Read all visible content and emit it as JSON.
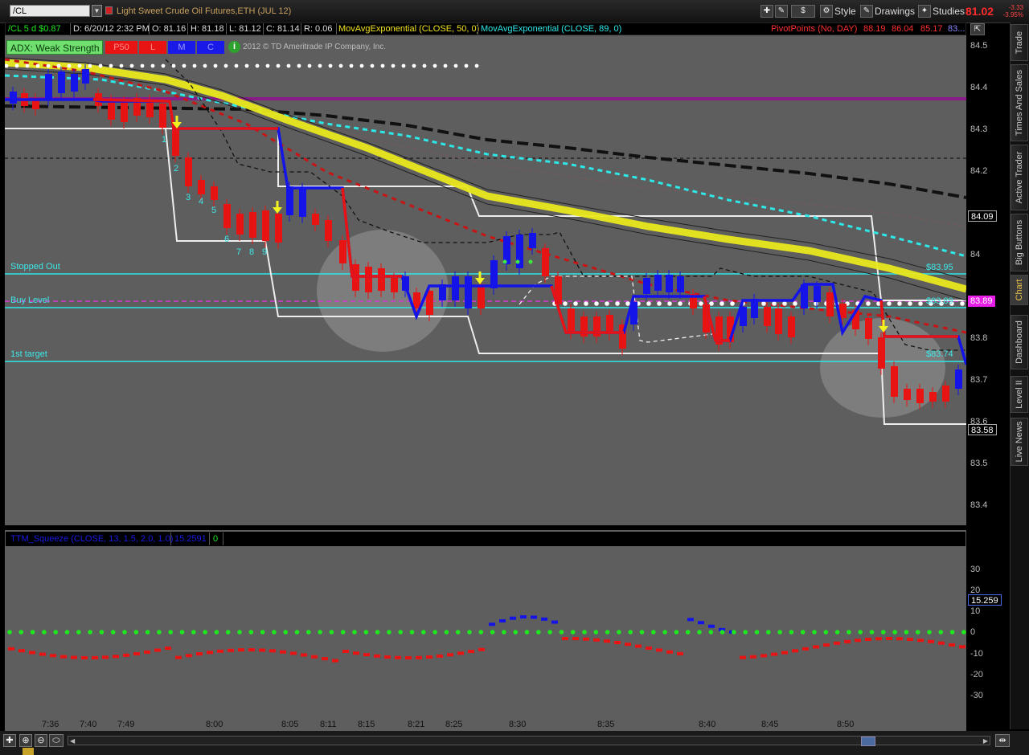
{
  "toolbar": {
    "symbol": "/CL",
    "instrument": "Light Sweet Crude Oil Futures,ETH (JUL 12)",
    "style_label": "Style",
    "drawings_label": "Drawings",
    "studies_label": "Studies",
    "dollar_label": "$",
    "last_price": "81.02",
    "change": "-3.33",
    "change_pct": "-3.95%"
  },
  "infobar": {
    "symbol_desc": "/CL 5 d $0.87",
    "date": "D: 6/20/12 2:32 PM",
    "open": "O: 81.16",
    "high": "H: 81.18",
    "low": "L: 81.12",
    "close": "C: 81.14",
    "range": "R: 0.06",
    "ema50": "MovAvgExponential (CLOSE, 50, 0)",
    "ema89": "MovAvgExponential (CLOSE, 89, 0)",
    "pivot": "PivotPoints (No, DAY)",
    "pivot_vals": [
      "88.19",
      "86.04",
      "85.17",
      "83..."
    ]
  },
  "chart_header": {
    "adx": "ADX: Weak Strength",
    "buttons": [
      "P50",
      "L",
      "M",
      "C"
    ],
    "copyright": "2012 © TD Ameritrade IP Company, Inc."
  },
  "annotations": {
    "stopped_out": "Stopped Out",
    "buy_level": "Buy Level",
    "first_target": "1st target",
    "r_stop": "$83.95",
    "r_buy": "$83.89",
    "r_target": "$83.74"
  },
  "counts": [
    "1",
    "2",
    "3",
    "4",
    "5",
    "6",
    "7",
    "8",
    "9"
  ],
  "price_axis": {
    "ticks": [
      "84.5",
      "84.4",
      "84.3",
      "84.2",
      "84",
      "83.8",
      "83.7",
      "83.6",
      "83.5",
      "83.4"
    ],
    "tag_high": "84.09",
    "tag_current": "83.89",
    "tag_low": "83.58"
  },
  "lower": {
    "study": "TTM_Squeeze (CLOSE, 13, 1.5, 2.0, 1.0)",
    "value": "15.2591",
    "zero": "0",
    "ticks": [
      "30",
      "20",
      "10",
      "0",
      "-10",
      "-20",
      "-30"
    ],
    "tag": "15.259"
  },
  "time_axis": [
    "7:36",
    "7:40",
    "7:49",
    "8:00",
    "8:05",
    "8:11",
    "8:15",
    "8:21",
    "8:25",
    "8:30",
    "8:35",
    "8:40",
    "8:45",
    "8:50"
  ],
  "sidebar": [
    "Trade",
    "Times And Sales",
    "Active Trader",
    "Big Buttons",
    "Chart",
    "Dashboard",
    "Level II",
    "Live News"
  ],
  "colors": {
    "bull": "#1414e8",
    "bear": "#e81414",
    "ema50": "#f2f21e",
    "ema89": "#2ee8e8",
    "pane": "#5e5e5e",
    "pivot": "#8a1a8a"
  }
}
